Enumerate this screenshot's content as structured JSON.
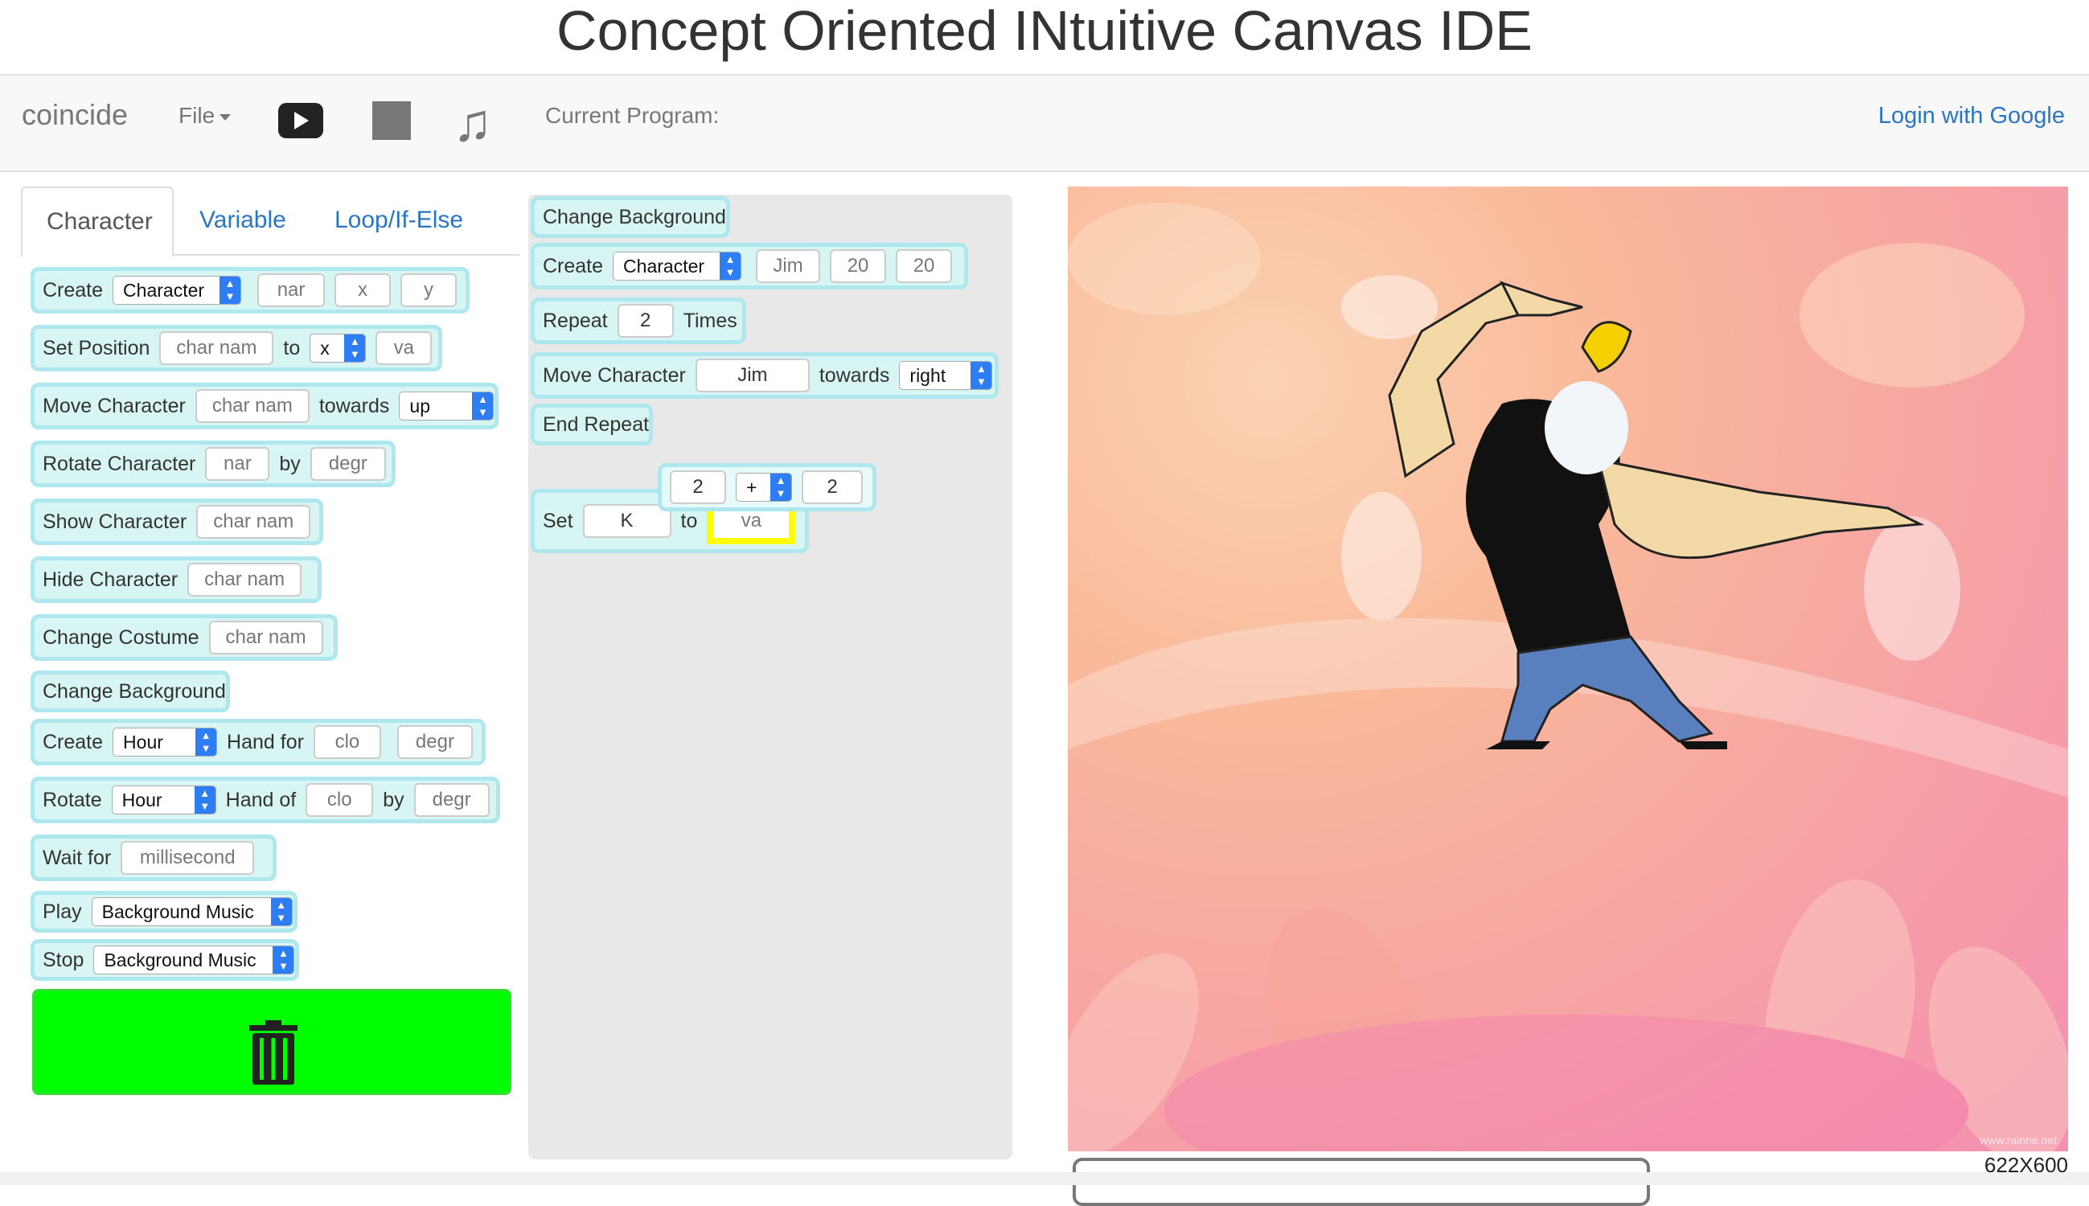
{
  "header": {
    "title": "Concept Oriented INtuitive Canvas IDE"
  },
  "navbar": {
    "brand": "coincide",
    "file_label": "File",
    "current_program_label": "Current Program:",
    "login_label": "Login with Google"
  },
  "tabs": [
    "Character",
    "Variable",
    "Loop/If-Else"
  ],
  "palette": {
    "create": {
      "label": "Create",
      "type": "Character",
      "name_ph": "nar",
      "x_ph": "x",
      "y_ph": "y"
    },
    "set_position": {
      "label": "Set Position",
      "char_ph": "char nam",
      "to": "to",
      "axis": "x",
      "value_ph": "va"
    },
    "move_character": {
      "label": "Move Character",
      "char_ph": "char nam",
      "towards": "towards",
      "direction": "up"
    },
    "rotate_character": {
      "label": "Rotate Character",
      "name_ph": "nar",
      "by": "by",
      "deg_ph": "degr"
    },
    "show_character": {
      "label": "Show Character",
      "char_ph": "char nam"
    },
    "hide_character": {
      "label": "Hide Character",
      "char_ph": "char nam"
    },
    "change_costume": {
      "label": "Change Costume",
      "char_ph": "char nam"
    },
    "change_background": {
      "label": "Change Background"
    },
    "create_hand": {
      "label": "Create",
      "hand": "Hour",
      "hand_for": "Hand for",
      "clock_ph": "clo",
      "deg_ph": "degr"
    },
    "rotate_hand": {
      "label": "Rotate",
      "hand": "Hour",
      "hand_of": "Hand of",
      "clock_ph": "clo",
      "by": "by",
      "deg_ph": "degr"
    },
    "wait_for": {
      "label": "Wait for",
      "ms_ph": "millisecond"
    },
    "play": {
      "label": "Play",
      "music": "Background Music"
    },
    "stop": {
      "label": "Stop",
      "music": "Background Music"
    }
  },
  "workspace": {
    "change_background": "Change Background",
    "create": {
      "label": "Create",
      "type": "Character",
      "name": "Jim",
      "x": "20",
      "y": "20"
    },
    "repeat": {
      "label": "Repeat",
      "count": "2",
      "times": "Times"
    },
    "move": {
      "label": "Move Character",
      "char": "Jim",
      "towards": "towards",
      "direction": "right"
    },
    "end_repeat": "End Repeat",
    "set": {
      "label": "Set",
      "var": "K",
      "to": "to",
      "value_ph": "va"
    },
    "expr": {
      "left": "2",
      "op": "+",
      "right": "2"
    }
  },
  "stage": {
    "size_label": "622X600",
    "watermark": "www.rainne.net"
  },
  "colors": {
    "block_bg": "#d6f5f3",
    "block_border": "#aee8ee",
    "trash": "#00ff00",
    "link": "#2a76c4"
  }
}
